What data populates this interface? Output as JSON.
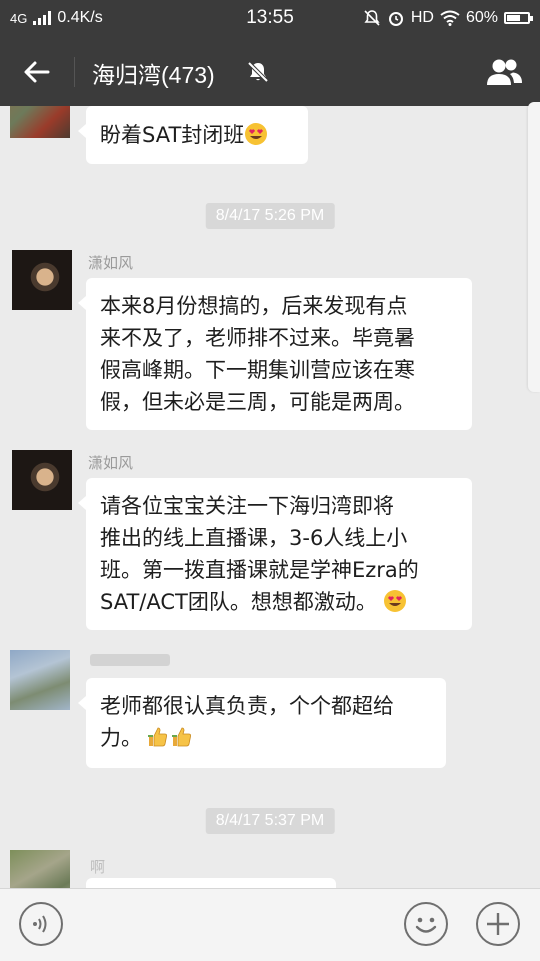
{
  "status_bar": {
    "network": "4G",
    "speed": "0.4K/s",
    "time": "13:55",
    "hd": "HD",
    "battery": "60%",
    "battery_level": 0.6
  },
  "header": {
    "title": "海归湾(473)"
  },
  "messages": [
    {
      "type": "text",
      "avatar": "blurred-avatar",
      "text": "盼着SAT封闭班",
      "emoji": "heart-eyes"
    },
    {
      "type": "time",
      "text": "8/4/17 5:26 PM"
    },
    {
      "type": "text",
      "avatar": "man-avatar",
      "name": "潇如风",
      "lines": [
        "本来8月份想搞的，后来发现有点",
        "来不及了，老师排不过来。毕竟暑",
        "假高峰期。下一期集训营应该在寒",
        "假，但未必是三周，可能是两周。"
      ]
    },
    {
      "type": "text",
      "avatar": "man-avatar",
      "name": "潇如风",
      "lines": [
        "请各位宝宝关注一下海归湾即将",
        "推出的线上直播课，3-6人线上小",
        "班。第一拨直播课就是学神Ezra的",
        "SAT/ACT团队。想想都激动。"
      ],
      "emoji": "heart-eyes"
    },
    {
      "type": "text",
      "avatar": "blurred-avatar",
      "lines": [
        "老师都很认真负责，个个都超给",
        "力。"
      ],
      "emoji": "thumbs-up-thumbs-up"
    },
    {
      "type": "time",
      "text": "8/4/17 5:37 PM"
    },
    {
      "type": "text",
      "avatar": "blurred-avatar",
      "name": "啊"
    }
  ],
  "input_bar": {
    "voice_icon": "voice-icon",
    "emoji_icon": "smiley-icon",
    "add_icon": "plus-icon"
  },
  "colors": {
    "bar_bg": "#3b3b3b",
    "chat_bg": "#ebebeb",
    "bubble_bg": "#ffffff",
    "timestamp_bg": "#d8d8d8"
  }
}
